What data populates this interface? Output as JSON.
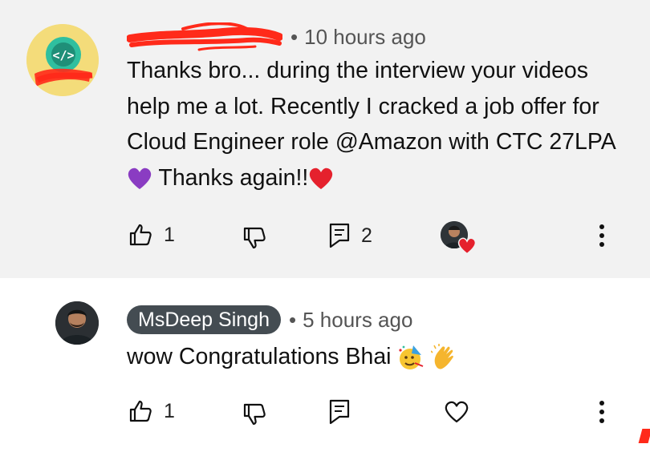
{
  "comments": [
    {
      "author": "",
      "time": "10 hours ago",
      "text": "Thanks bro... during the interview your videos help me a lot. Recently I cracked a job offer for Cloud Engineer role @Amazon with CTC 27LPA",
      "text_after_heart": "Thanks again!!",
      "likes": "1",
      "replies": "2",
      "creator_hearted": true
    },
    {
      "author": "MsDeep Singh",
      "time": "5 hours ago",
      "text": "wow Congratulations Bhai",
      "likes": "1"
    }
  ],
  "icons": {
    "like": "thumbs-up-icon",
    "dislike": "thumbs-down-icon",
    "reply": "comment-icon",
    "heart": "heart-outline-icon",
    "more": "more-vertical-icon"
  },
  "colors": {
    "top_background": "#f2f2f2",
    "name_chip": "#444c52",
    "heart_red": "#e5212d",
    "purple_heart": "#8a3cc2",
    "redaction": "#ff2a1a"
  },
  "dot": "•"
}
